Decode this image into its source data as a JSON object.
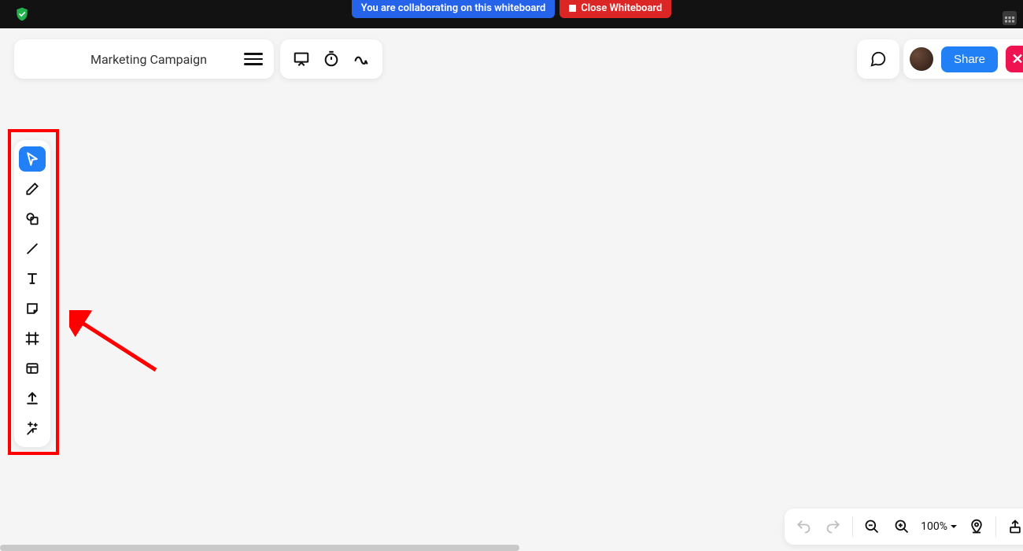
{
  "topbar": {
    "collab_banner": "You are collaborating on this whiteboard",
    "close_banner": "Close Whiteboard"
  },
  "titlecard": {
    "title": "Marketing Campaign"
  },
  "tools": {
    "select": "select",
    "draw": "draw",
    "shapes": "shapes",
    "line": "line",
    "text": "text",
    "sticky": "sticky",
    "frame": "frame",
    "table": "table",
    "upload": "upload",
    "more": "more"
  },
  "share": {
    "share_label": "Share",
    "close_label": "✕"
  },
  "zoom": {
    "level": "100%"
  }
}
